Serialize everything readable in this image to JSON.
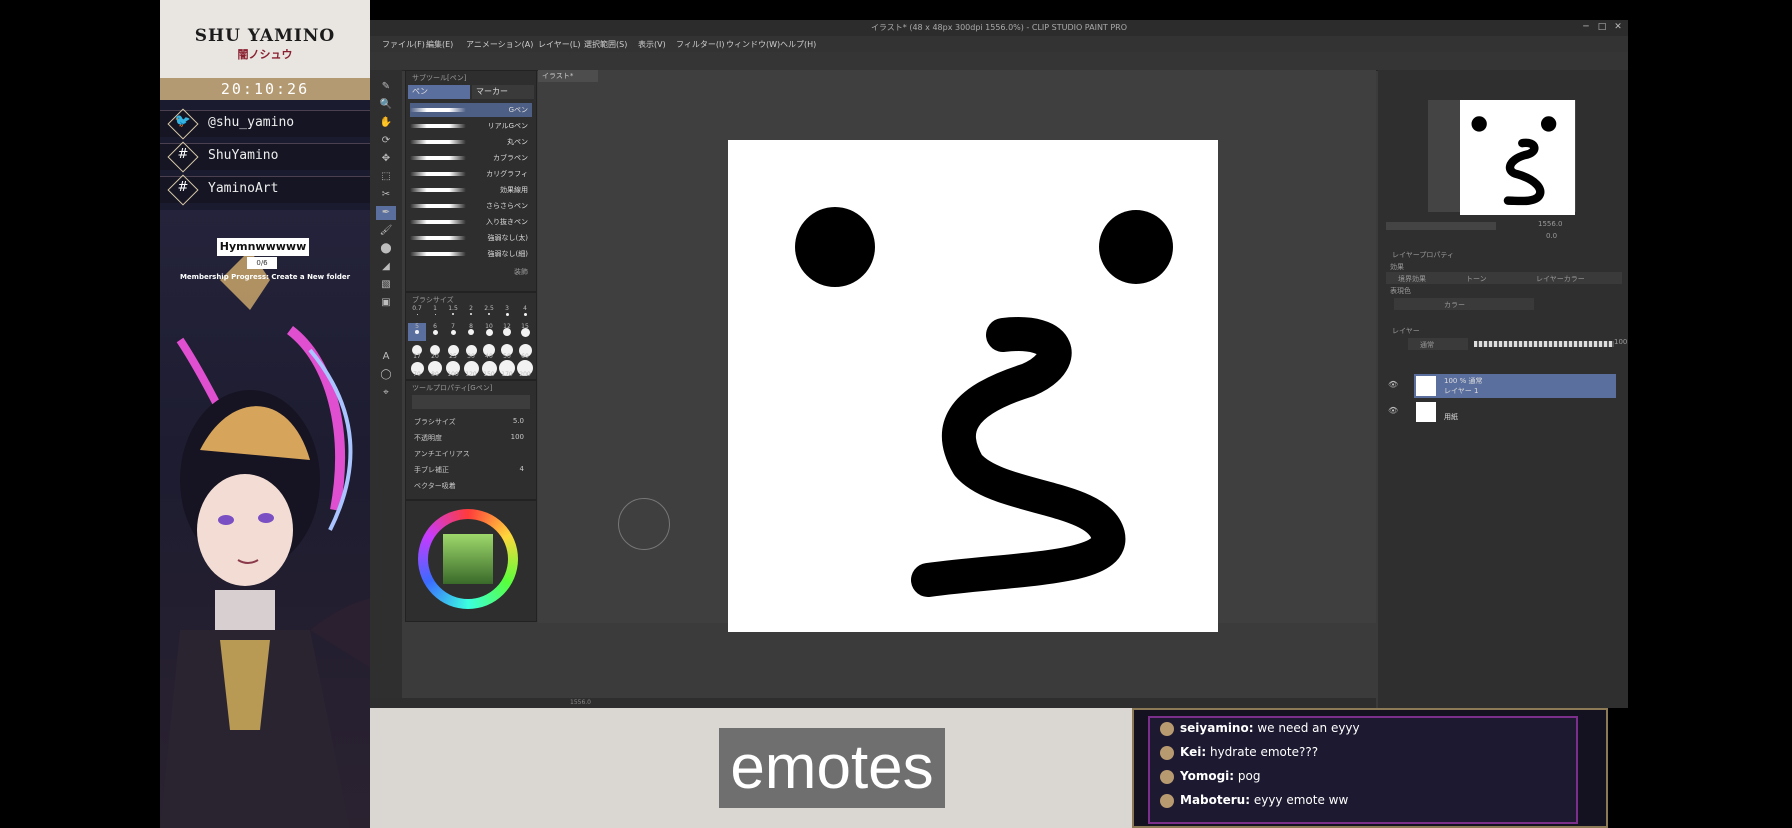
{
  "overlay": {
    "name": "SHU YAMINO",
    "name_jp": "闇ノシュウ",
    "clock": "20:10:26",
    "socials": [
      {
        "icon": "twitter-icon",
        "glyph": "🐦",
        "text": "@shu_yamino"
      },
      {
        "icon": "hashtag-icon",
        "glyph": "#",
        "text": "ShuYamino"
      },
      {
        "icon": "hashtag-icon",
        "glyph": "#",
        "text": "YaminoArt"
      }
    ],
    "goal": {
      "title": "Hymnwwwww",
      "count": "0/6",
      "description": "Membership Progress: Create a New folder"
    }
  },
  "window": {
    "title": "イラスト* (48 x 48px 300dpi 1556.0%) - CLIP STUDIO PAINT PRO",
    "controls": [
      "─",
      "□",
      "✕"
    ]
  },
  "menu": [
    "ファイル(F)",
    "編集(E)",
    "アニメーション(A)",
    "レイヤー(L)",
    "選択範囲(S)",
    "表示(V)",
    "フィルター(I)",
    "ウィンドウ(W)",
    "ヘルプ(H)"
  ],
  "tools": [
    "✎",
    "🔍",
    "✋",
    "⟳",
    "✥",
    "⬚",
    "✂",
    "✒",
    "🖌",
    "⬤",
    "◢",
    "▧",
    "▣",
    "A",
    "◯",
    "⌖"
  ],
  "subtool": {
    "header": "サブツール[ペン]",
    "tabs": [
      "ペン",
      "マーカー"
    ],
    "brushes": [
      "Gペン",
      "リアルGペン",
      "丸ペン",
      "カブラペン",
      "カリグラフィ",
      "効果線用",
      "さらさらペン",
      "入り抜きペン",
      "強弱なし(太)",
      "強弱なし(細)"
    ],
    "footer": "装飾"
  },
  "brush_sizes": {
    "header": "ブラシサイズ",
    "row1_labels": [
      "0.7",
      "1",
      "1.5",
      "2",
      "2.5",
      "3",
      "4"
    ],
    "row2_labels": [
      "5",
      "6",
      "7",
      "8",
      "10",
      "12",
      "15"
    ],
    "row3_labels": [
      "17",
      "20",
      "25",
      "30",
      "40",
      "50",
      "60"
    ],
    "row4_labels": [
      "70",
      "80",
      "100",
      "120",
      "150",
      "170",
      "200"
    ]
  },
  "tool_property": {
    "header": "ツールプロパティ[Gペン]",
    "rows": [
      {
        "label": "ブラシサイズ",
        "value": "5.0"
      },
      {
        "label": "不透明度",
        "value": "100"
      },
      {
        "label": "アンチエイリアス",
        "value": ""
      },
      {
        "label": "手ブレ補正",
        "value": "4"
      },
      {
        "label": "ベクター吸着",
        "value": ""
      }
    ]
  },
  "canvas": {
    "tab": "イラスト*",
    "status": "1556.0",
    "accent": "#5b6f9e"
  },
  "navigator": {
    "zoom": "1556.0",
    "angle": "0.0"
  },
  "layer_property": {
    "header": "レイヤープロパティ",
    "effect_label": "効果",
    "effect_buttons": [
      "境界効果",
      "トーン",
      "レイヤーカラー"
    ],
    "color_label": "表現色",
    "color_value": "カラー"
  },
  "layers": {
    "header": "レイヤー",
    "blend": "通常",
    "opacity": "100",
    "items": [
      {
        "name": "100 % 通常",
        "sub": "レイヤー 1",
        "selected": true
      },
      {
        "name": "",
        "sub": "用紙",
        "selected": false
      }
    ]
  },
  "caption": {
    "text": "emotes"
  },
  "chat": [
    {
      "user": "seiyamino:",
      "message": "we need an eyyy"
    },
    {
      "user": "Kei:",
      "message": "hydrate emote???"
    },
    {
      "user": "Yomogi:",
      "message": "pog"
    },
    {
      "user": "Maboteru:",
      "message": "eyyy emote ww"
    }
  ]
}
